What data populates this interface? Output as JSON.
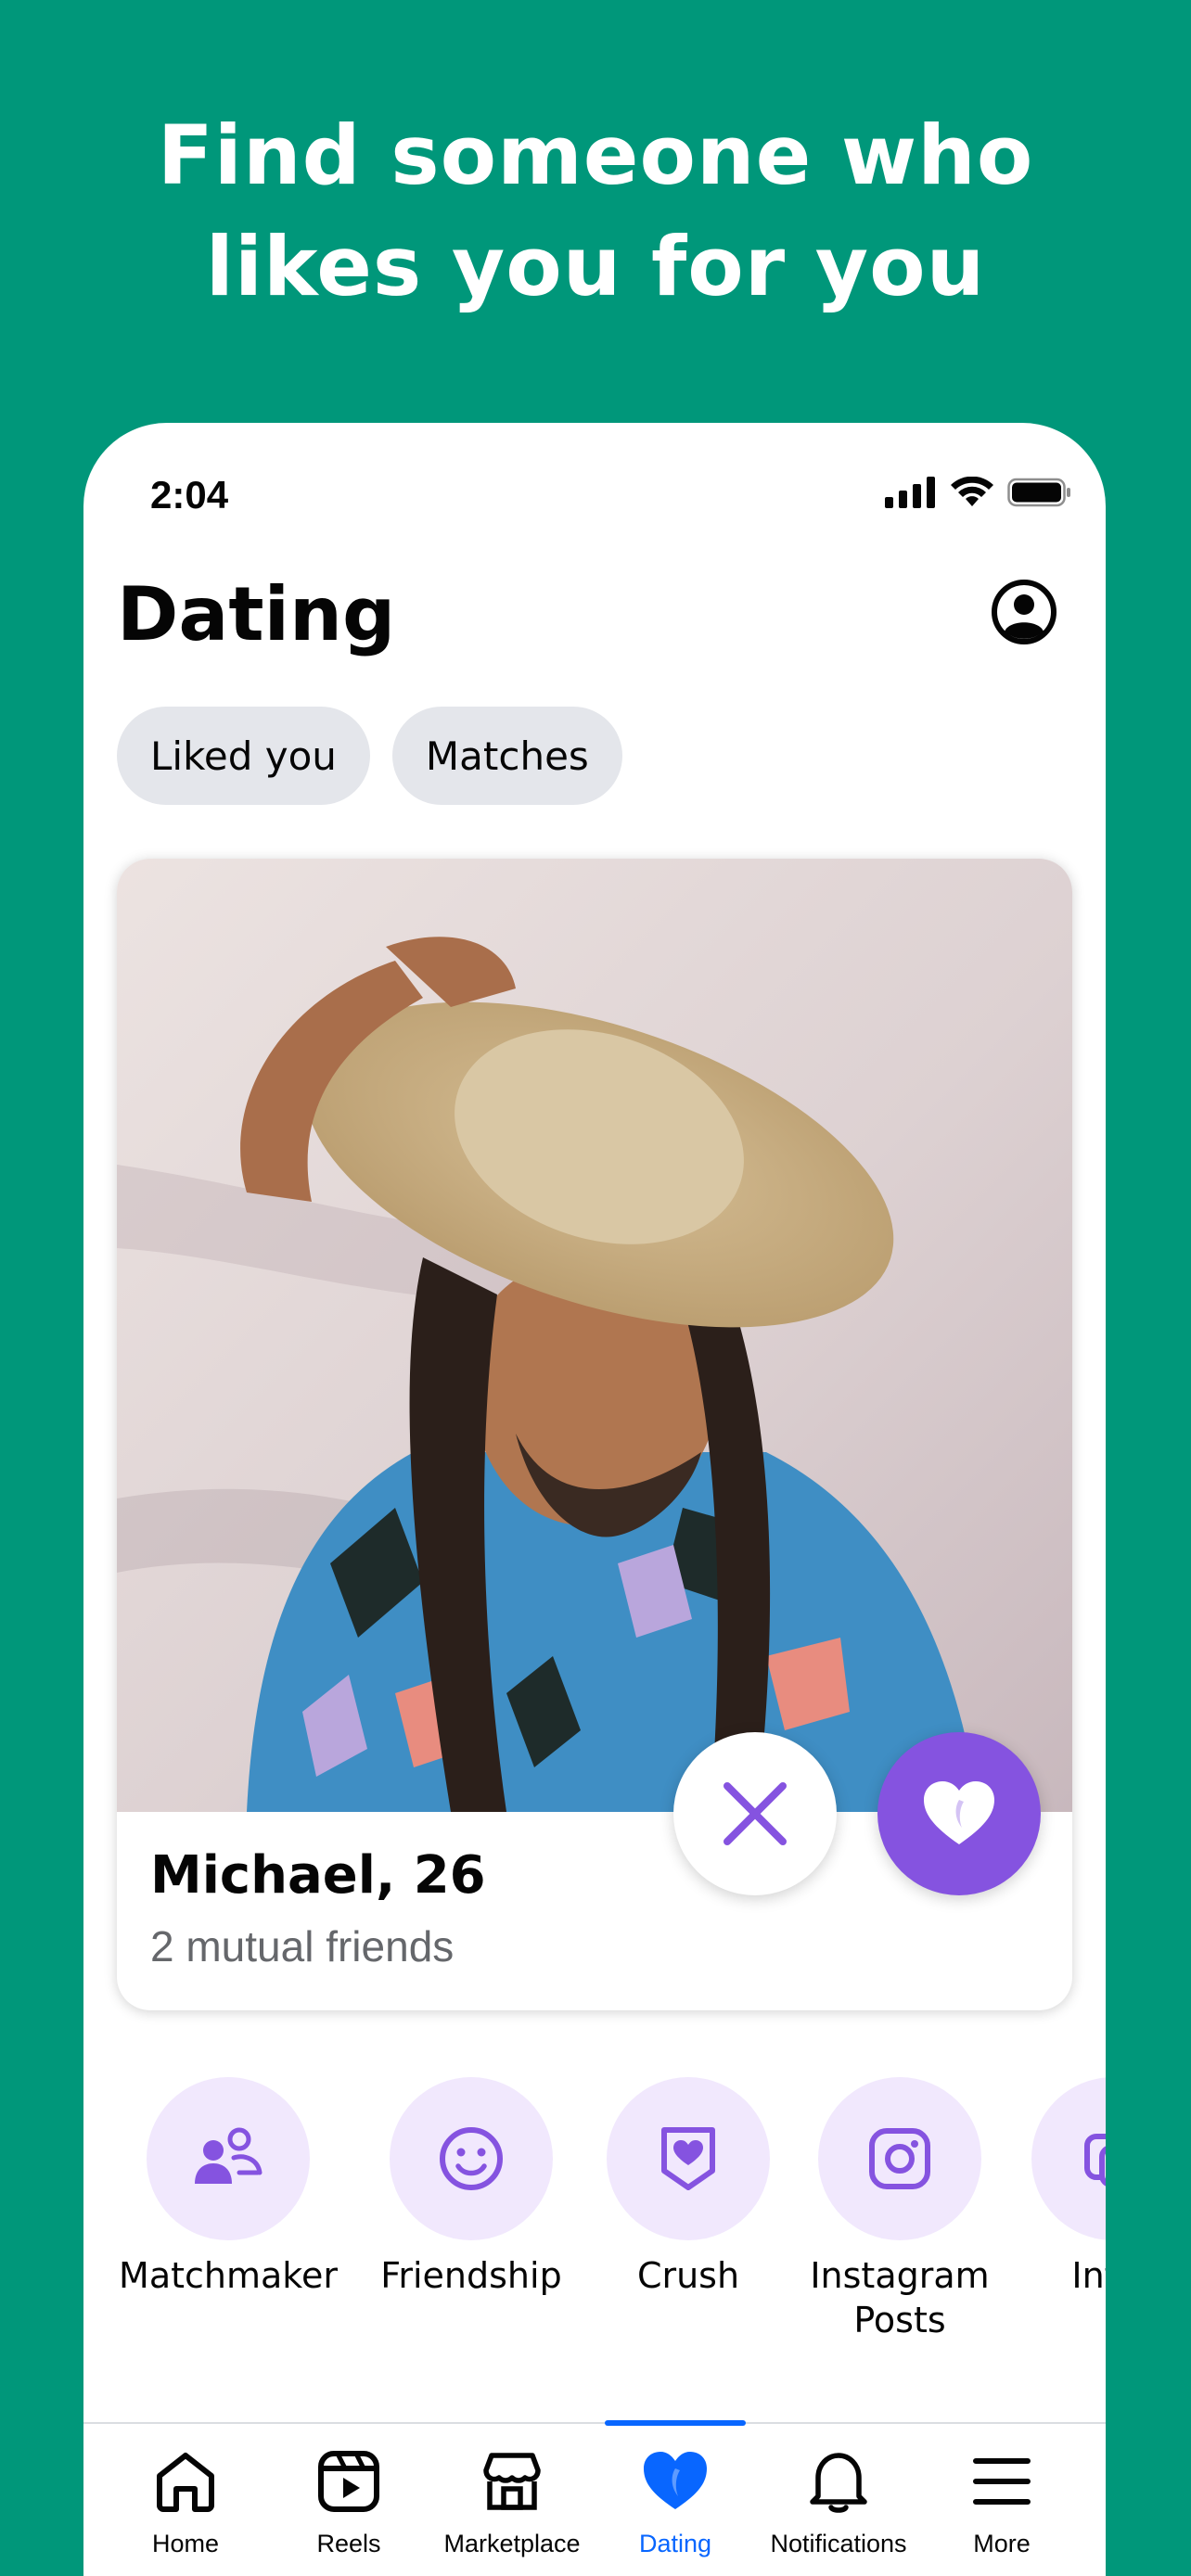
{
  "promo": {
    "headline_line1": "Find someone who",
    "headline_line2": "likes you for you"
  },
  "status_bar": {
    "time": "2:04",
    "icons": [
      "cellular-signal-icon",
      "wifi-icon",
      "battery-icon"
    ]
  },
  "header": {
    "title": "Dating",
    "profile_icon": "profile-icon"
  },
  "chips": [
    {
      "label": "Liked you"
    },
    {
      "label": "Matches"
    }
  ],
  "profile_card": {
    "name": "Michael, 26",
    "subtitle": "2 mutual friends",
    "pass_icon": "close-icon",
    "like_icon": "heart-icon"
  },
  "features": [
    {
      "label": "Matchmaker",
      "icon": "matchmaker-icon"
    },
    {
      "label": "Friendship",
      "icon": "smiley-icon"
    },
    {
      "label": "Crush",
      "icon": "crush-icon"
    },
    {
      "label": "Instagram Posts",
      "icon": "instagram-icon"
    },
    {
      "label": "Inter",
      "icon": "interests-icon"
    }
  ],
  "tab_bar": {
    "active": "Dating",
    "tabs": [
      {
        "label": "Home",
        "icon": "home-icon"
      },
      {
        "label": "Reels",
        "icon": "reels-icon"
      },
      {
        "label": "Marketplace",
        "icon": "marketplace-icon"
      },
      {
        "label": "Dating",
        "icon": "dating-heart-icon"
      },
      {
        "label": "Notifications",
        "icon": "bell-icon"
      },
      {
        "label": "More",
        "icon": "menu-icon"
      }
    ]
  },
  "colors": {
    "background": "#00977a",
    "accent_purple": "#8553e0",
    "feature_circle": "#f1e8fd",
    "active_tab": "#0866ff",
    "chip_bg": "#e4e6eb"
  }
}
